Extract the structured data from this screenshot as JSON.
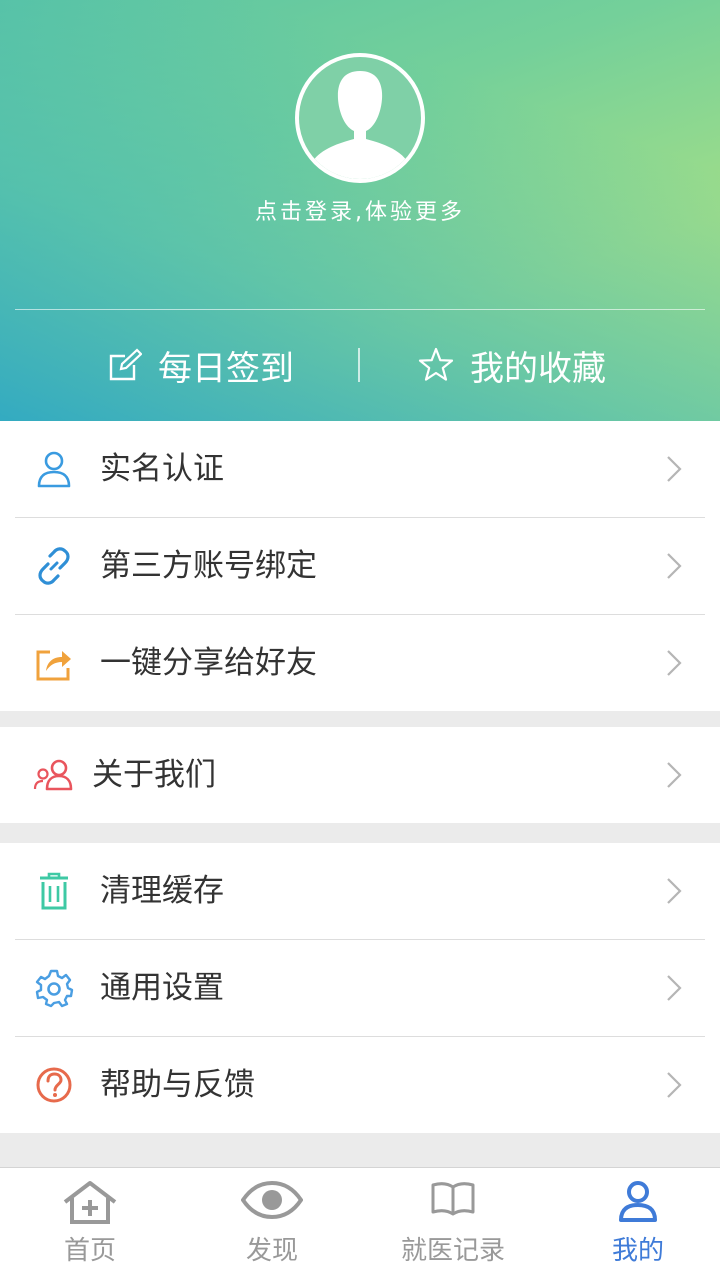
{
  "header": {
    "login_hint": "点击登录,体验更多",
    "checkin_label": "每日签到",
    "favorites_label": "我的收藏"
  },
  "menu": {
    "group1": [
      {
        "label": "实名认证",
        "icon": "user-icon",
        "color": "#3a9be0"
      },
      {
        "label": "第三方账号绑定",
        "icon": "link-icon",
        "color": "#2f8fd6"
      },
      {
        "label": "一键分享给好友",
        "icon": "share-icon",
        "color": "#f0a23c"
      }
    ],
    "group2": [
      {
        "label": "关于我们",
        "icon": "users-icon",
        "color": "#e9555d"
      }
    ],
    "group3": [
      {
        "label": "清理缓存",
        "icon": "trash-icon",
        "color": "#3ec9a4"
      },
      {
        "label": "通用设置",
        "icon": "gear-icon",
        "color": "#4a9ee2"
      },
      {
        "label": "帮助与反馈",
        "icon": "help-icon",
        "color": "#e76a4c"
      }
    ]
  },
  "tabs": [
    {
      "label": "首页",
      "icon": "home-icon",
      "active": false
    },
    {
      "label": "发现",
      "icon": "eye-icon",
      "active": false
    },
    {
      "label": "就医记录",
      "icon": "book-icon",
      "active": false
    },
    {
      "label": "我的",
      "icon": "profile-icon",
      "active": true
    }
  ],
  "colors": {
    "tab_active": "#3f7bd8",
    "tab_inactive": "#999999"
  }
}
